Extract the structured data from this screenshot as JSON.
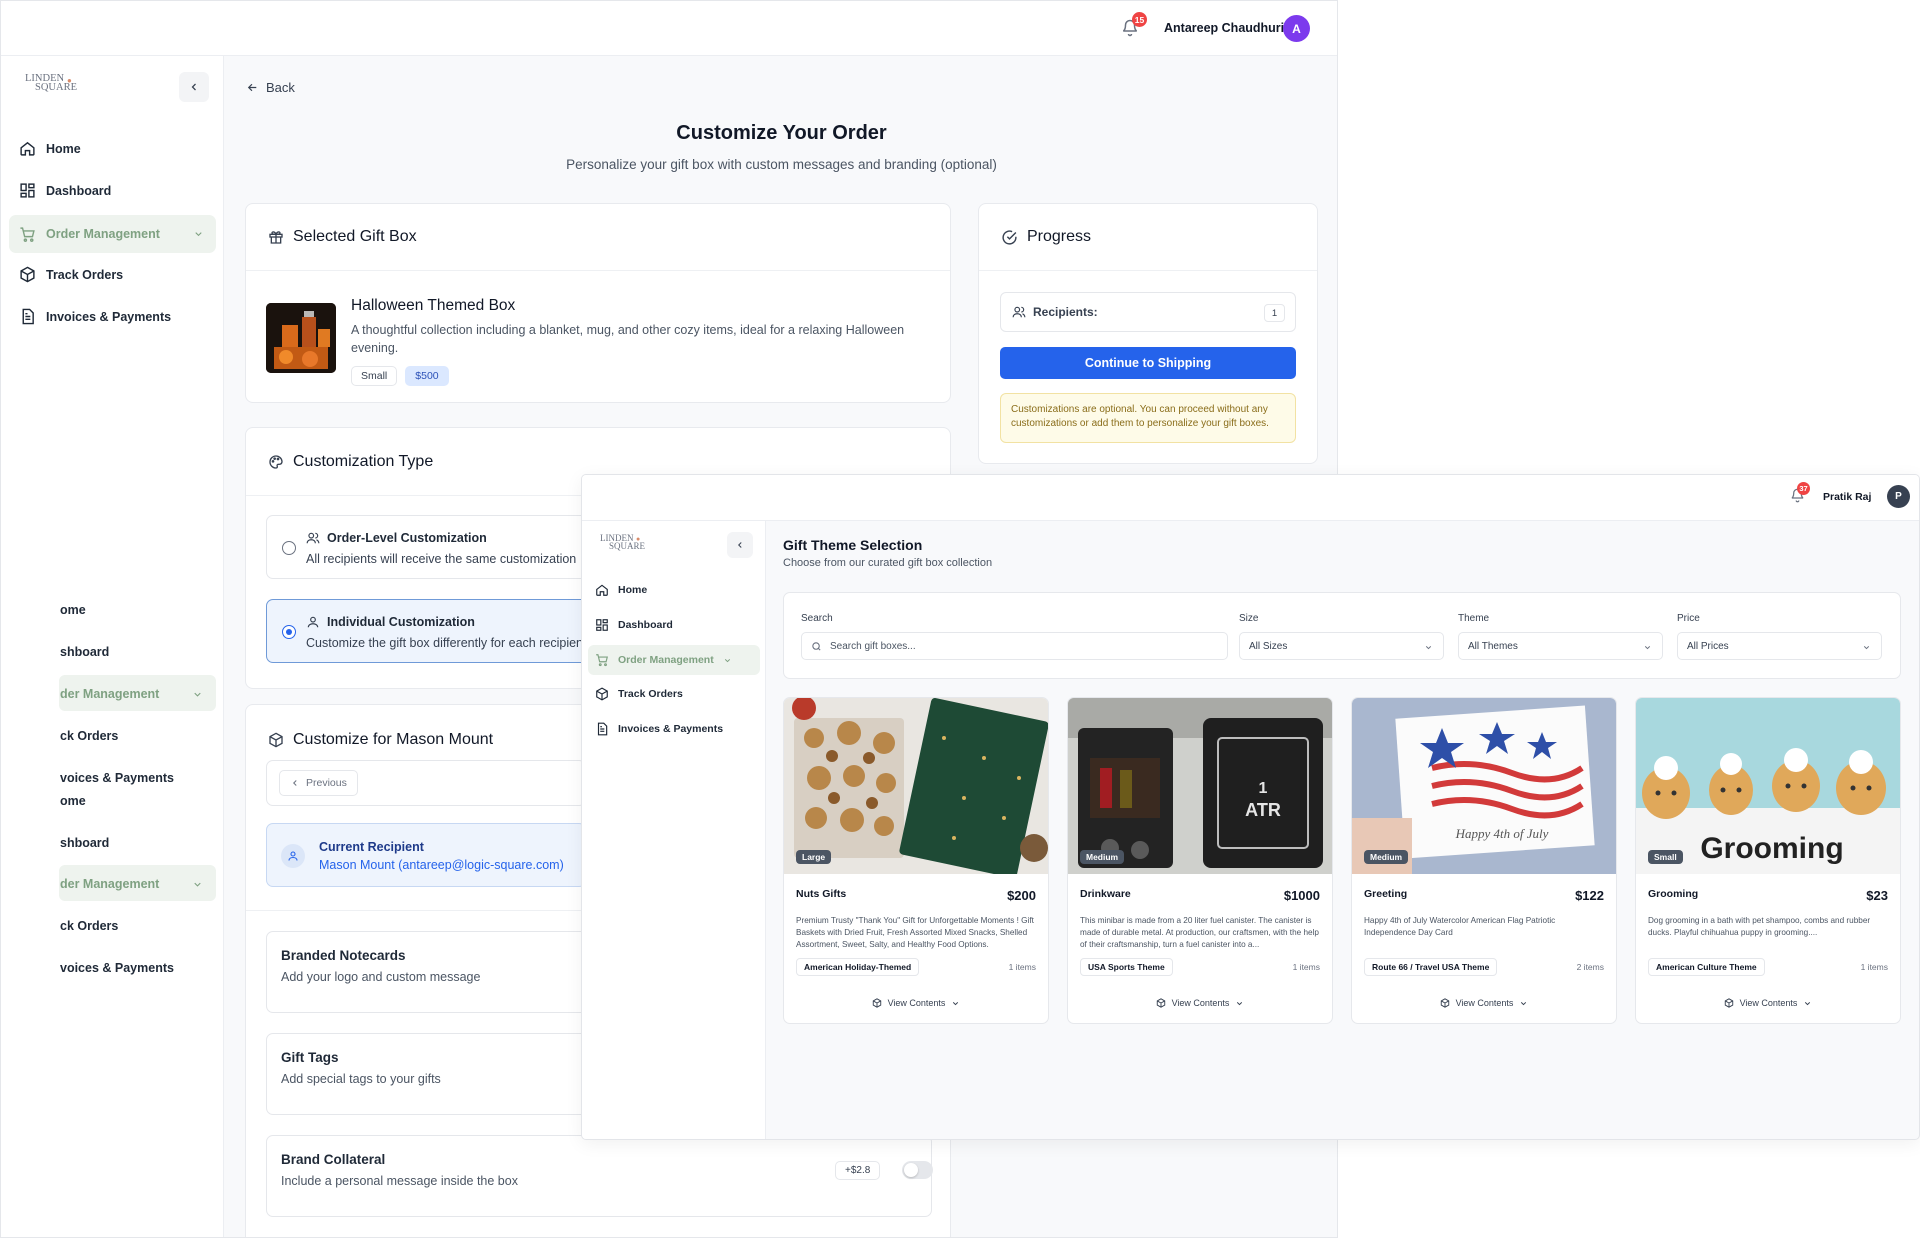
{
  "back_window": {
    "user": {
      "name": "Antareep Chaudhuri",
      "initial": "A",
      "notifications": "15",
      "avatar_color": "#7c3aed"
    },
    "brand": {
      "line1": "LINDEN",
      "line2": "SQUARE"
    },
    "nav": [
      {
        "label": "Home",
        "icon": "home-icon"
      },
      {
        "label": "Dashboard",
        "icon": "dashboard-icon"
      },
      {
        "label": "Order Management",
        "icon": "cart-icon"
      },
      {
        "label": "Track Orders",
        "icon": "package-icon"
      },
      {
        "label": "Invoices & Payments",
        "icon": "invoice-icon"
      }
    ],
    "ghost_nav": [
      "ome",
      "shboard",
      "der Management",
      "ck Orders",
      "voices & Payments",
      "ome",
      "shboard",
      "der Management",
      "ck Orders",
      "voices & Payments"
    ],
    "back_label": "Back",
    "page_title": "Customize Your Order",
    "page_subtitle": "Personalize your gift box with custom messages and branding (optional)",
    "selected_box": {
      "heading": "Selected Gift Box",
      "name": "Halloween Themed Box",
      "description": "A thoughtful collection including a blanket, mug, and other cozy items, ideal for a relaxing Halloween evening.",
      "size": "Small",
      "price": "$500"
    },
    "customization": {
      "heading": "Customization Type",
      "options": [
        {
          "title": "Order-Level Customization",
          "subtitle": "All recipients will receive the same customization"
        },
        {
          "title": "Individual Customization",
          "subtitle": "Customize the gift box differently for each recipient"
        }
      ]
    },
    "customize_for": {
      "heading": "Customize for Mason Mount",
      "previous_label": "Previous",
      "current_label": "Current Recipient",
      "current_value": "Mason Mount (antareep@logic-square.com)"
    },
    "addons": [
      {
        "title": "Branded Notecards",
        "subtitle": "Add your logo and custom message"
      },
      {
        "title": "Gift Tags",
        "subtitle": "Add special tags to your gifts"
      },
      {
        "title": "Brand Collateral",
        "subtitle": "Include a personal message inside the box",
        "price": "+$2.8"
      }
    ],
    "progress": {
      "heading": "Progress",
      "recipients_label": "Recipients:",
      "recipients_count": "1",
      "continue_label": "Continue to Shipping",
      "note": "Customizations are optional. You can proceed without any customizations or add them to personalize your gift boxes."
    },
    "accent": "#2563eb"
  },
  "front_window": {
    "user": {
      "name": "Pratik Raj",
      "initial": "P",
      "notifications": "37",
      "avatar_color": "#374151"
    },
    "brand": {
      "line1": "LINDEN",
      "line2": "SQUARE"
    },
    "nav": [
      {
        "label": "Home",
        "icon": "home-icon"
      },
      {
        "label": "Dashboard",
        "icon": "dashboard-icon"
      },
      {
        "label": "Order Management",
        "icon": "cart-icon"
      },
      {
        "label": "Track Orders",
        "icon": "package-icon"
      },
      {
        "label": "Invoices & Payments",
        "icon": "invoice-icon"
      }
    ],
    "title": "Gift Theme Selection",
    "subtitle": "Choose from our curated gift box collection",
    "filters": {
      "search_label": "Search",
      "search_placeholder": "Search gift boxes...",
      "size_label": "Size",
      "size_value": "All Sizes",
      "theme_label": "Theme",
      "theme_value": "All Themes",
      "price_label": "Price",
      "price_value": "All Prices"
    },
    "products": [
      {
        "size": "Large",
        "name": "Nuts Gifts",
        "price": "$200",
        "description": "Premium Trusty \"Thank You\" Gift for Unforgettable Moments ! Gift Baskets with Dried Fruit, Fresh Assorted Mixed Snacks, Shelled Assortment, Sweet, Salty, and Healthy Food Options.",
        "theme": "American Holiday-Themed",
        "items": "1 items",
        "view": "View Contents"
      },
      {
        "size": "Medium",
        "name": "Drinkware",
        "price": "$1000",
        "description": "This minibar is made from a 20 liter fuel canister. The canister is made of durable metal. At production, our craftsmen, with the help of their craftsmanship, turn a fuel canister into a...",
        "theme": "USA Sports Theme",
        "items": "1 items",
        "view": "View Contents",
        "img_text": "ATR",
        "img_num": "1"
      },
      {
        "size": "Medium",
        "name": "Greeting",
        "price": "$122",
        "description": "Happy 4th of July Watercolor American Flag Patriotic Independence Day Card",
        "theme": "Route 66 / Travel USA Theme",
        "items": "2 items",
        "view": "View Contents",
        "img_text": "Happy 4th of July"
      },
      {
        "size": "Small",
        "name": "Grooming",
        "price": "$23",
        "description": "Dog grooming in a bath with pet shampoo, combs and rubber ducks. Playful chihuahua puppy in grooming....",
        "theme": "American Culture Theme",
        "items": "1 items",
        "view": "View Contents",
        "img_text": "Grooming"
      }
    ]
  }
}
